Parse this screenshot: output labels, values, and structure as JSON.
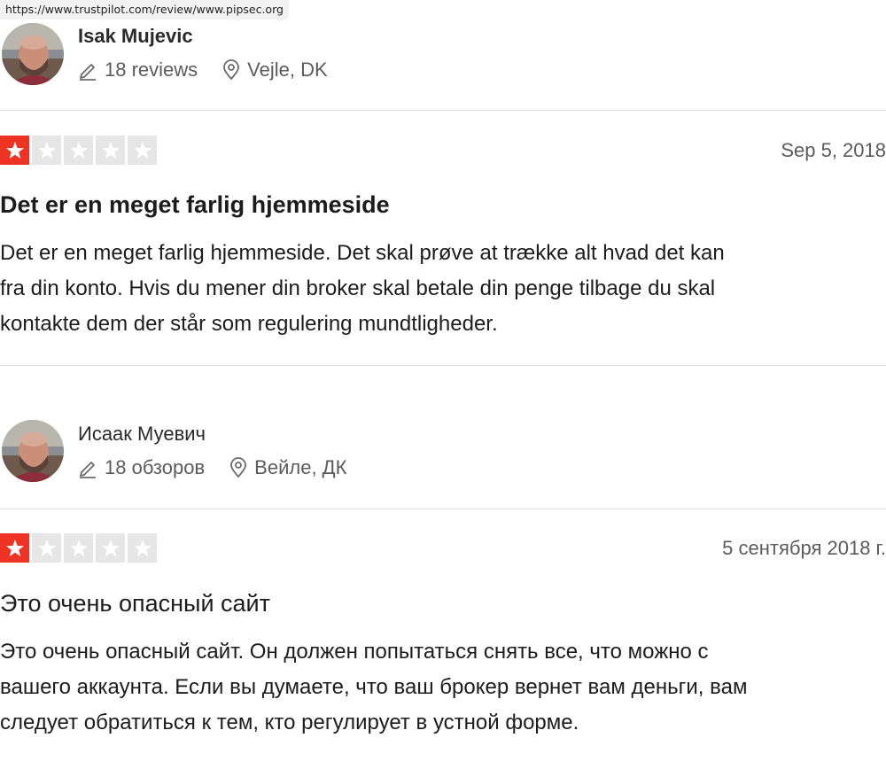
{
  "url": "https://www.trustpilot.com/review/www.pipsec.org",
  "colors": {
    "star_on": "#ee3223",
    "star_off": "#e6e6e6",
    "divider": "#dcdcdc"
  },
  "icons": {
    "reviews": "pencil-icon",
    "location": "location-pin-icon",
    "star": "star-icon"
  },
  "reviews": [
    {
      "reviewer_name": "Isak Mujevic",
      "review_count": "18 reviews",
      "location": "Vejle, DK",
      "rating": 1,
      "date": "Sep 5, 2018",
      "title": "Det er en meget farlig hjemmeside",
      "body_lines": [
        "Det er en meget farlig hjemmeside. Det skal prøve at trække alt hvad det kan",
        "fra din konto. Hvis du mener din broker skal betale din penge tilbage du skal",
        "kontakte dem der står som regulering mundtligheder."
      ]
    },
    {
      "reviewer_name": "Исаак Муевич",
      "review_count": "18 обзоров",
      "location": "Вейле, ДК",
      "rating": 1,
      "date": "5 сентября 2018 г.",
      "title": "Это очень опасный сайт",
      "body_lines": [
        "Это очень опасный сайт. Он должен попытаться снять все, что можно с",
        "вашего аккаунта. Если вы думаете, что ваш брокер вернет вам деньги, вам",
        "следует обратиться к тем, кто регулирует в устной форме."
      ]
    }
  ]
}
